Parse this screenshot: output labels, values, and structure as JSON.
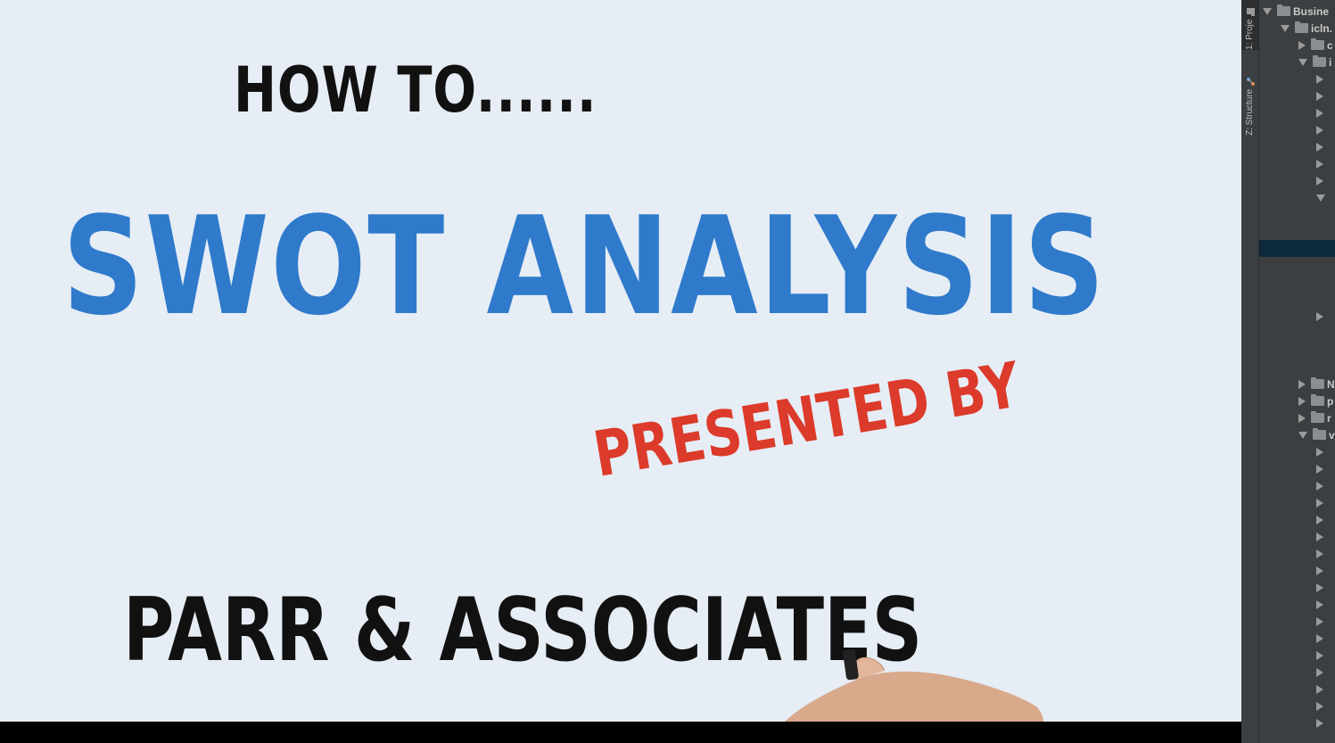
{
  "video": {
    "line1": "HOW TO......",
    "line2": "SWOT ANALYSIS",
    "line3": "PRESENTED BY",
    "line4": "PARR & ASSOCIATES",
    "colors": {
      "background": "#e6edf5",
      "title": "#2f7acb",
      "accent": "#dc3a2a",
      "text": "#111111"
    }
  },
  "ide": {
    "tool_tabs": [
      {
        "label": "1: Proje",
        "icon": "folder-icon"
      },
      {
        "label": "Z: Structure",
        "icon": "structure-icon"
      }
    ],
    "tree": [
      {
        "label": "Busine",
        "arrow": "down",
        "folder": true,
        "indent": 0
      },
      {
        "label": "icln.",
        "arrow": "down",
        "folder": true,
        "indent": 1
      },
      {
        "label": "c",
        "arrow": "right",
        "folder": true,
        "indent": 2
      },
      {
        "label": "i",
        "arrow": "down",
        "folder": true,
        "indent": 2
      },
      {
        "label": "",
        "arrow": "right",
        "folder": false,
        "indent": 3
      },
      {
        "label": "",
        "arrow": "right",
        "folder": false,
        "indent": 3
      },
      {
        "label": "",
        "arrow": "right",
        "folder": false,
        "indent": 3
      },
      {
        "label": "",
        "arrow": "right",
        "folder": false,
        "indent": 3
      },
      {
        "label": "",
        "arrow": "right",
        "folder": false,
        "indent": 3
      },
      {
        "label": "",
        "arrow": "right",
        "folder": false,
        "indent": 3
      },
      {
        "label": "",
        "arrow": "right",
        "folder": false,
        "indent": 3
      },
      {
        "label": "",
        "arrow": "down",
        "folder": false,
        "indent": 3
      },
      {
        "label": "",
        "arrow": "none",
        "folder": false,
        "indent": 3
      },
      {
        "label": "",
        "arrow": "none",
        "folder": false,
        "indent": 3
      },
      {
        "label": "",
        "arrow": "none",
        "folder": false,
        "indent": 3,
        "selected": true
      },
      {
        "label": "",
        "arrow": "none",
        "folder": false,
        "indent": 3
      },
      {
        "label": "",
        "arrow": "none",
        "folder": false,
        "indent": 3
      },
      {
        "label": "",
        "arrow": "none",
        "folder": false,
        "indent": 3
      },
      {
        "label": "",
        "arrow": "right",
        "folder": false,
        "indent": 3
      },
      {
        "label": "",
        "arrow": "none",
        "folder": false,
        "indent": 3
      },
      {
        "label": "",
        "arrow": "none",
        "folder": false,
        "indent": 3
      },
      {
        "label": "",
        "arrow": "none",
        "folder": false,
        "indent": 3
      },
      {
        "label": "N",
        "arrow": "right",
        "folder": true,
        "indent": 2
      },
      {
        "label": "p",
        "arrow": "right",
        "folder": true,
        "indent": 2
      },
      {
        "label": "r",
        "arrow": "right",
        "folder": true,
        "indent": 2
      },
      {
        "label": "v",
        "arrow": "down",
        "folder": true,
        "indent": 2
      },
      {
        "label": "",
        "arrow": "right",
        "folder": false,
        "indent": 3
      },
      {
        "label": "",
        "arrow": "right",
        "folder": false,
        "indent": 3
      },
      {
        "label": "",
        "arrow": "right",
        "folder": false,
        "indent": 3
      },
      {
        "label": "",
        "arrow": "right",
        "folder": false,
        "indent": 3
      },
      {
        "label": "",
        "arrow": "right",
        "folder": false,
        "indent": 3
      },
      {
        "label": "",
        "arrow": "right",
        "folder": false,
        "indent": 3
      },
      {
        "label": "",
        "arrow": "right",
        "folder": false,
        "indent": 3
      },
      {
        "label": "",
        "arrow": "right",
        "folder": false,
        "indent": 3
      },
      {
        "label": "",
        "arrow": "right",
        "folder": false,
        "indent": 3
      },
      {
        "label": "",
        "arrow": "right",
        "folder": false,
        "indent": 3
      },
      {
        "label": "",
        "arrow": "right",
        "folder": false,
        "indent": 3
      },
      {
        "label": "",
        "arrow": "right",
        "folder": false,
        "indent": 3
      },
      {
        "label": "",
        "arrow": "right",
        "folder": false,
        "indent": 3
      },
      {
        "label": "",
        "arrow": "right",
        "folder": false,
        "indent": 3
      },
      {
        "label": "",
        "arrow": "right",
        "folder": false,
        "indent": 3
      },
      {
        "label": "",
        "arrow": "right",
        "folder": false,
        "indent": 3
      },
      {
        "label": "",
        "arrow": "right",
        "folder": false,
        "indent": 3
      }
    ]
  }
}
